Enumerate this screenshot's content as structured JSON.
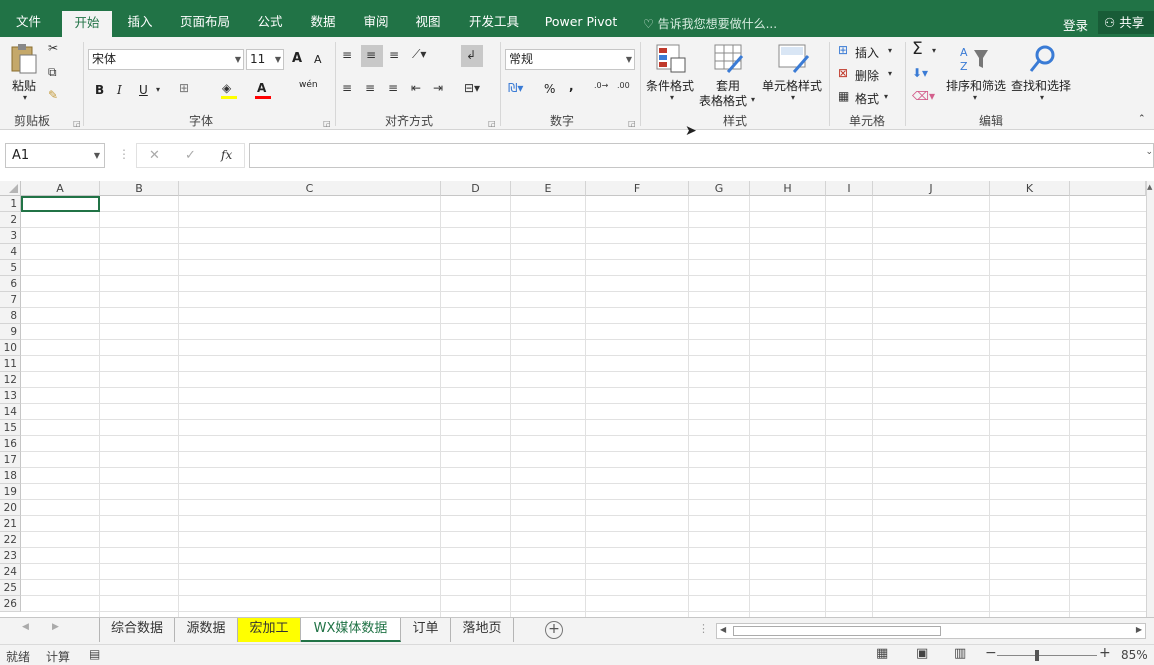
{
  "ribbon_tabs": [
    "文件",
    "开始",
    "插入",
    "页面布局",
    "公式",
    "数据",
    "审阅",
    "视图",
    "开发工具",
    "Power Pivot"
  ],
  "active_tab": "开始",
  "tell_me": "告诉我您想要做什么...",
  "login": "登录",
  "share": "共享",
  "clipboard": {
    "paste": "粘贴",
    "group": "剪贴板"
  },
  "font": {
    "name": "宋体",
    "size": "11",
    "group": "字体",
    "bold": "B",
    "italic": "I",
    "underline": "U",
    "grow": "A",
    "shrink": "A",
    "wen": "wén"
  },
  "alignment": {
    "group": "对齐方式"
  },
  "number": {
    "format": "常规",
    "group": "数字",
    "percent": "%",
    "comma": ","
  },
  "styles": {
    "conditional": "条件格式",
    "table_1": "套用",
    "table_2": "表格格式",
    "cell_styles": "单元格样式",
    "group": "样式"
  },
  "cells": {
    "insert": "插入",
    "delete": "删除",
    "format": "格式",
    "group": "单元格"
  },
  "editing": {
    "sort": "排序和筛选",
    "find": "查找和选择",
    "group": "编辑",
    "sigma": "Σ"
  },
  "name_box": "A1",
  "fx": "fx",
  "columns": [
    "A",
    "B",
    "C",
    "D",
    "E",
    "F",
    "G",
    "H",
    "I",
    "J",
    "K"
  ],
  "rows": [
    "1",
    "2",
    "3",
    "4",
    "5",
    "6",
    "7",
    "8",
    "9",
    "10",
    "11",
    "12",
    "13",
    "14",
    "15",
    "16",
    "17",
    "18",
    "19",
    "20",
    "21",
    "22",
    "23",
    "24",
    "25",
    "26"
  ],
  "sheets": [
    {
      "name": "综合数据",
      "state": "normal"
    },
    {
      "name": "源数据",
      "state": "normal"
    },
    {
      "name": "宏加工",
      "state": "highlight"
    },
    {
      "name": "WX媒体数据",
      "state": "active"
    },
    {
      "name": "订单",
      "state": "normal"
    },
    {
      "name": "落地页",
      "state": "normal"
    }
  ],
  "status": {
    "ready": "就绪",
    "calc": "计算",
    "zoom": "85%"
  },
  "colors": {
    "accent": "#217346",
    "highlight_sheet": "#ffff00"
  }
}
